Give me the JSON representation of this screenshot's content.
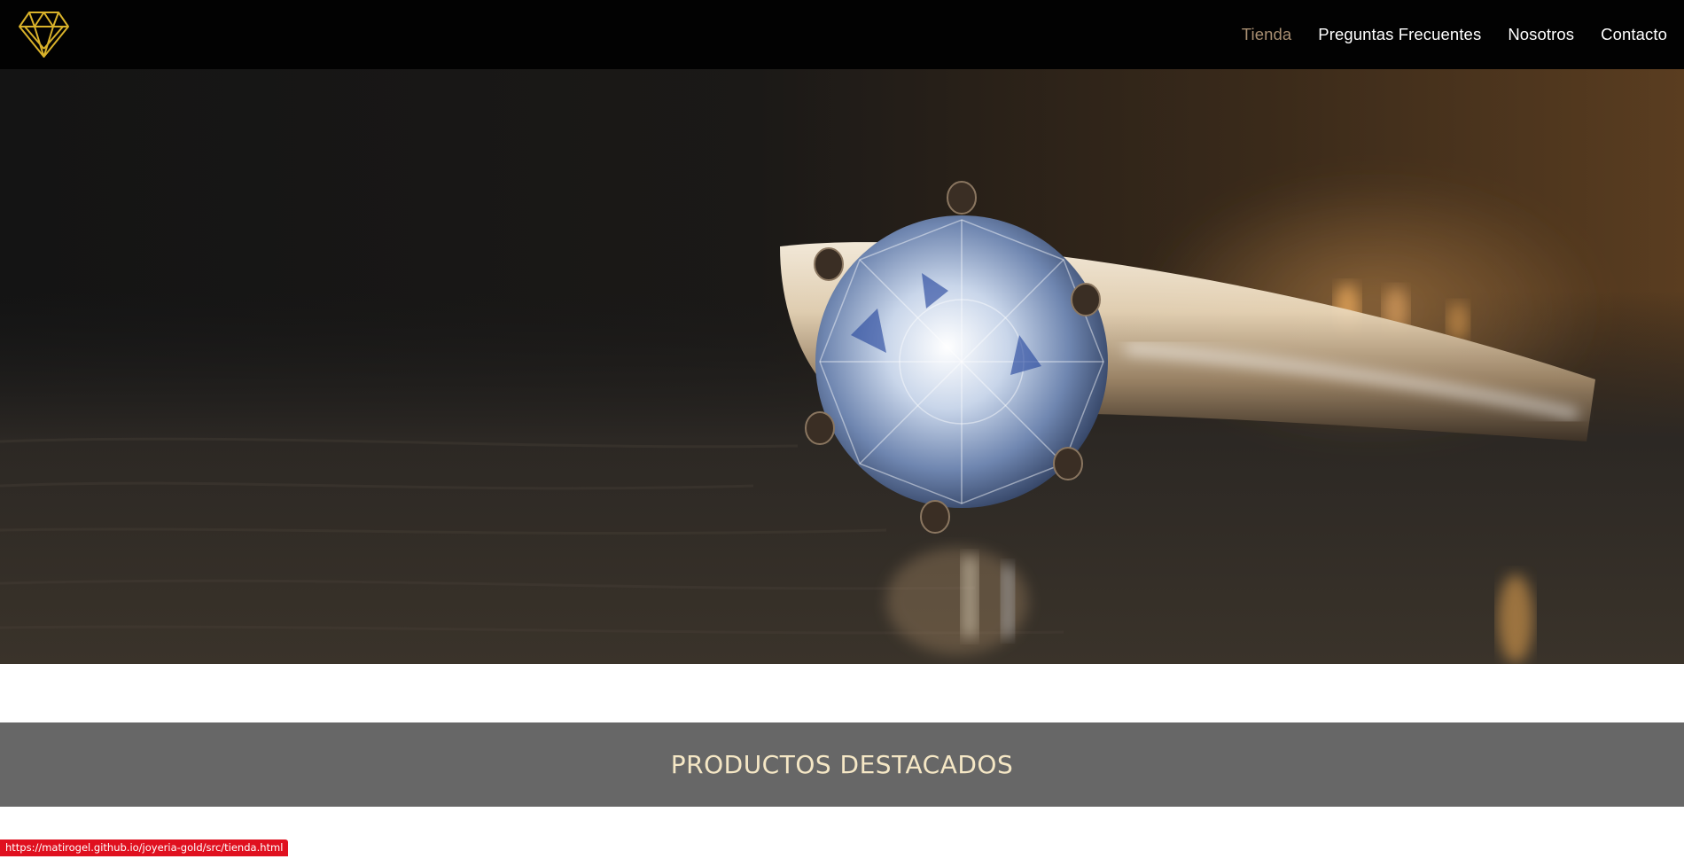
{
  "header": {
    "logo_name": "diamond-logo",
    "nav": [
      {
        "label": "Tienda",
        "active": true
      },
      {
        "label": "Preguntas Frecuentes",
        "active": false
      },
      {
        "label": "Nosotros",
        "active": false
      },
      {
        "label": "Contacto",
        "active": false
      }
    ]
  },
  "hero": {
    "image": "diamond-ring-photo"
  },
  "featured": {
    "title": "PRODUCTOS DESTACADOS"
  },
  "status_bar": {
    "url": "https://matirogel.github.io/joyeria-gold/src/tienda.html"
  },
  "colors": {
    "navbar_bg": "#020202",
    "active_link": "#a98f72",
    "banner_bg": "#676767",
    "banner_text": "#f5e7c5",
    "logo_gold": "#d9b22a",
    "status_bg": "#e0101f"
  }
}
